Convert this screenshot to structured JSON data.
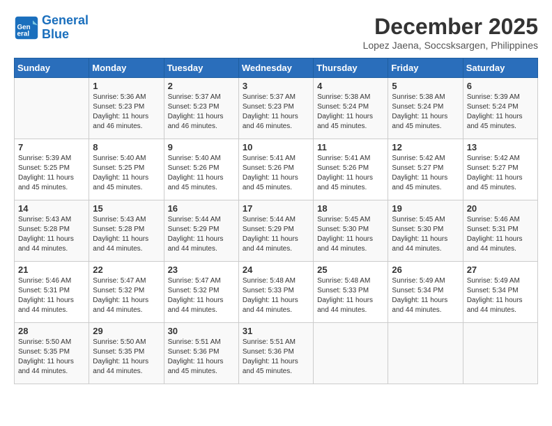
{
  "logo": {
    "line1": "General",
    "line2": "Blue"
  },
  "title": "December 2025",
  "location": "Lopez Jaena, Soccsksargen, Philippines",
  "days_header": [
    "Sunday",
    "Monday",
    "Tuesday",
    "Wednesday",
    "Thursday",
    "Friday",
    "Saturday"
  ],
  "weeks": [
    [
      {
        "day": "",
        "sunrise": "",
        "sunset": "",
        "daylight": ""
      },
      {
        "day": "1",
        "sunrise": "Sunrise: 5:36 AM",
        "sunset": "Sunset: 5:23 PM",
        "daylight": "Daylight: 11 hours and 46 minutes."
      },
      {
        "day": "2",
        "sunrise": "Sunrise: 5:37 AM",
        "sunset": "Sunset: 5:23 PM",
        "daylight": "Daylight: 11 hours and 46 minutes."
      },
      {
        "day": "3",
        "sunrise": "Sunrise: 5:37 AM",
        "sunset": "Sunset: 5:23 PM",
        "daylight": "Daylight: 11 hours and 46 minutes."
      },
      {
        "day": "4",
        "sunrise": "Sunrise: 5:38 AM",
        "sunset": "Sunset: 5:24 PM",
        "daylight": "Daylight: 11 hours and 45 minutes."
      },
      {
        "day": "5",
        "sunrise": "Sunrise: 5:38 AM",
        "sunset": "Sunset: 5:24 PM",
        "daylight": "Daylight: 11 hours and 45 minutes."
      },
      {
        "day": "6",
        "sunrise": "Sunrise: 5:39 AM",
        "sunset": "Sunset: 5:24 PM",
        "daylight": "Daylight: 11 hours and 45 minutes."
      }
    ],
    [
      {
        "day": "7",
        "sunrise": "Sunrise: 5:39 AM",
        "sunset": "Sunset: 5:25 PM",
        "daylight": "Daylight: 11 hours and 45 minutes."
      },
      {
        "day": "8",
        "sunrise": "Sunrise: 5:40 AM",
        "sunset": "Sunset: 5:25 PM",
        "daylight": "Daylight: 11 hours and 45 minutes."
      },
      {
        "day": "9",
        "sunrise": "Sunrise: 5:40 AM",
        "sunset": "Sunset: 5:26 PM",
        "daylight": "Daylight: 11 hours and 45 minutes."
      },
      {
        "day": "10",
        "sunrise": "Sunrise: 5:41 AM",
        "sunset": "Sunset: 5:26 PM",
        "daylight": "Daylight: 11 hours and 45 minutes."
      },
      {
        "day": "11",
        "sunrise": "Sunrise: 5:41 AM",
        "sunset": "Sunset: 5:26 PM",
        "daylight": "Daylight: 11 hours and 45 minutes."
      },
      {
        "day": "12",
        "sunrise": "Sunrise: 5:42 AM",
        "sunset": "Sunset: 5:27 PM",
        "daylight": "Daylight: 11 hours and 45 minutes."
      },
      {
        "day": "13",
        "sunrise": "Sunrise: 5:42 AM",
        "sunset": "Sunset: 5:27 PM",
        "daylight": "Daylight: 11 hours and 45 minutes."
      }
    ],
    [
      {
        "day": "14",
        "sunrise": "Sunrise: 5:43 AM",
        "sunset": "Sunset: 5:28 PM",
        "daylight": "Daylight: 11 hours and 44 minutes."
      },
      {
        "day": "15",
        "sunrise": "Sunrise: 5:43 AM",
        "sunset": "Sunset: 5:28 PM",
        "daylight": "Daylight: 11 hours and 44 minutes."
      },
      {
        "day": "16",
        "sunrise": "Sunrise: 5:44 AM",
        "sunset": "Sunset: 5:29 PM",
        "daylight": "Daylight: 11 hours and 44 minutes."
      },
      {
        "day": "17",
        "sunrise": "Sunrise: 5:44 AM",
        "sunset": "Sunset: 5:29 PM",
        "daylight": "Daylight: 11 hours and 44 minutes."
      },
      {
        "day": "18",
        "sunrise": "Sunrise: 5:45 AM",
        "sunset": "Sunset: 5:30 PM",
        "daylight": "Daylight: 11 hours and 44 minutes."
      },
      {
        "day": "19",
        "sunrise": "Sunrise: 5:45 AM",
        "sunset": "Sunset: 5:30 PM",
        "daylight": "Daylight: 11 hours and 44 minutes."
      },
      {
        "day": "20",
        "sunrise": "Sunrise: 5:46 AM",
        "sunset": "Sunset: 5:31 PM",
        "daylight": "Daylight: 11 hours and 44 minutes."
      }
    ],
    [
      {
        "day": "21",
        "sunrise": "Sunrise: 5:46 AM",
        "sunset": "Sunset: 5:31 PM",
        "daylight": "Daylight: 11 hours and 44 minutes."
      },
      {
        "day": "22",
        "sunrise": "Sunrise: 5:47 AM",
        "sunset": "Sunset: 5:32 PM",
        "daylight": "Daylight: 11 hours and 44 minutes."
      },
      {
        "day": "23",
        "sunrise": "Sunrise: 5:47 AM",
        "sunset": "Sunset: 5:32 PM",
        "daylight": "Daylight: 11 hours and 44 minutes."
      },
      {
        "day": "24",
        "sunrise": "Sunrise: 5:48 AM",
        "sunset": "Sunset: 5:33 PM",
        "daylight": "Daylight: 11 hours and 44 minutes."
      },
      {
        "day": "25",
        "sunrise": "Sunrise: 5:48 AM",
        "sunset": "Sunset: 5:33 PM",
        "daylight": "Daylight: 11 hours and 44 minutes."
      },
      {
        "day": "26",
        "sunrise": "Sunrise: 5:49 AM",
        "sunset": "Sunset: 5:34 PM",
        "daylight": "Daylight: 11 hours and 44 minutes."
      },
      {
        "day": "27",
        "sunrise": "Sunrise: 5:49 AM",
        "sunset": "Sunset: 5:34 PM",
        "daylight": "Daylight: 11 hours and 44 minutes."
      }
    ],
    [
      {
        "day": "28",
        "sunrise": "Sunrise: 5:50 AM",
        "sunset": "Sunset: 5:35 PM",
        "daylight": "Daylight: 11 hours and 44 minutes."
      },
      {
        "day": "29",
        "sunrise": "Sunrise: 5:50 AM",
        "sunset": "Sunset: 5:35 PM",
        "daylight": "Daylight: 11 hours and 44 minutes."
      },
      {
        "day": "30",
        "sunrise": "Sunrise: 5:51 AM",
        "sunset": "Sunset: 5:36 PM",
        "daylight": "Daylight: 11 hours and 45 minutes."
      },
      {
        "day": "31",
        "sunrise": "Sunrise: 5:51 AM",
        "sunset": "Sunset: 5:36 PM",
        "daylight": "Daylight: 11 hours and 45 minutes."
      },
      {
        "day": "",
        "sunrise": "",
        "sunset": "",
        "daylight": ""
      },
      {
        "day": "",
        "sunrise": "",
        "sunset": "",
        "daylight": ""
      },
      {
        "day": "",
        "sunrise": "",
        "sunset": "",
        "daylight": ""
      }
    ]
  ]
}
